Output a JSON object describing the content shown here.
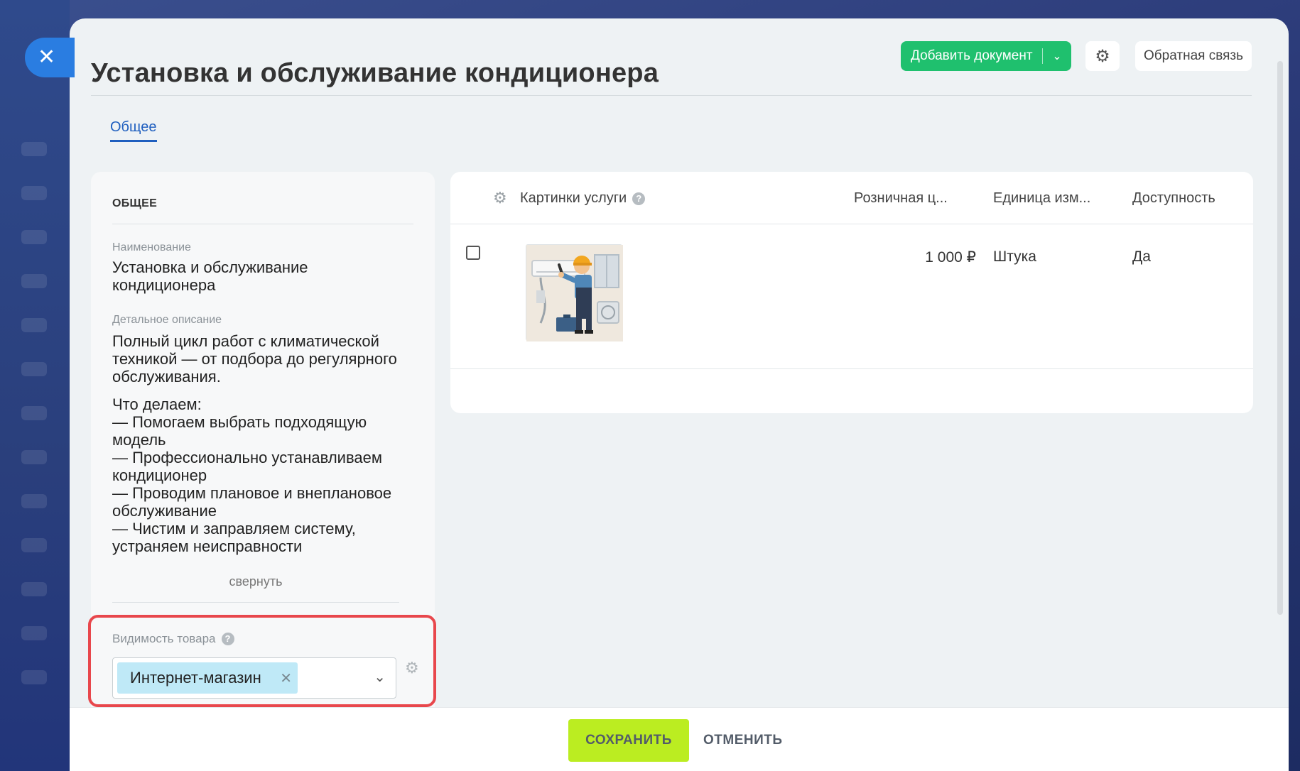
{
  "header": {
    "title": "Установка и обслуживание кондиционера",
    "add_document_label": "Добавить документ",
    "feedback_label": "Обратная связь"
  },
  "tabs": [
    {
      "label": "Общее",
      "active": true
    }
  ],
  "details": {
    "section_title": "ОБЩЕЕ",
    "name_label": "Наименование",
    "name_value": "Установка и обслуживание кондиционера",
    "description_label": "Детальное описание",
    "description_intro": "Полный цикл работ с климатической техникой — от подбора до регулярного обслуживания.",
    "description_list_title": "Что делаем:",
    "description_items": [
      "— Помогаем выбрать подходящую модель",
      "— Профессионально устанавливаем кондиционер",
      "— Проводим плановое и внеплановое обслуживание",
      "— Чистим и заправляем систему, устраняем неисправности"
    ],
    "collapse_label": "свернуть",
    "visibility_label": "Видимость товара",
    "visibility_tag": "Интернет-магазин"
  },
  "grid": {
    "columns": [
      "Картинки услуги",
      "Розничная ц...",
      "Единица изм...",
      "Доступность"
    ],
    "rows": [
      {
        "price": "1 000 ₽",
        "unit": "Штука",
        "availability": "Да"
      }
    ]
  },
  "footer": {
    "save_label": "СОХРАНИТЬ",
    "cancel_label": "ОТМЕНИТЬ"
  },
  "colors": {
    "accent_green": "#1fc06e",
    "save_lime": "#bbed21",
    "link_blue": "#1f5fbf",
    "highlight_red": "#e8474c",
    "tag_blue": "#bfe9f7"
  }
}
